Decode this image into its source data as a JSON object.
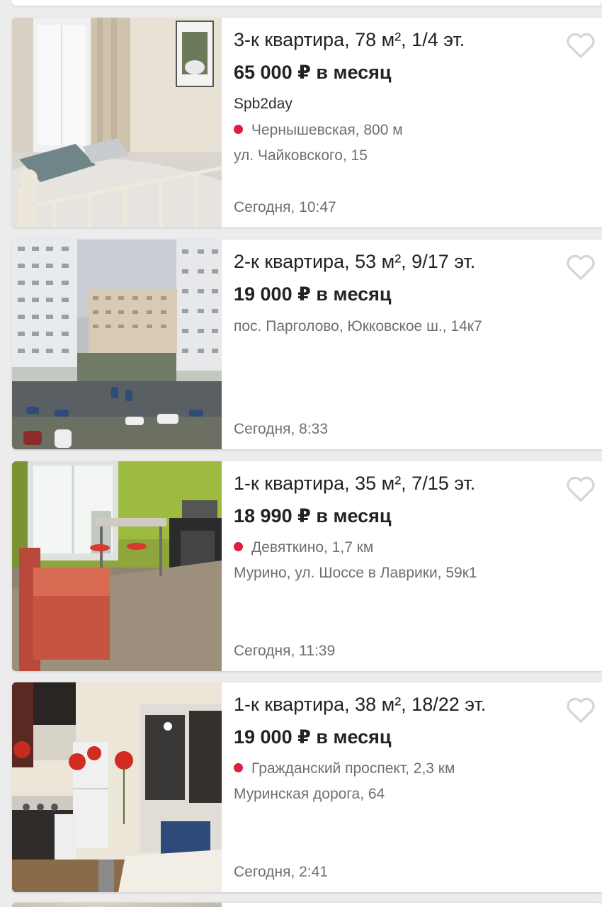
{
  "colors": {
    "background": "#ececec",
    "card": "#ffffff",
    "text_primary": "#222222",
    "text_secondary": "#6f6f6f",
    "metro_dot": "#dc1e41",
    "heart_outline": "#d5d5d5"
  },
  "listings": [
    {
      "title": "3-к квартира, 78 м², 1/4 эт.",
      "price": "65 000 ₽ в месяц",
      "seller": "Spb2day",
      "metro": "Чернышевская, 800 м",
      "address": "ул. Чайковского, 15",
      "date": "Сегодня, 10:47",
      "image_icon": "bedroom-photo",
      "favorite_icon": "heart-outline-icon"
    },
    {
      "title": "2-к квартира, 53 м², 9/17 эт.",
      "price": "19 000 ₽ в месяц",
      "address": "пос. Парголово, Юкковское ш., 14к7",
      "date": "Сегодня, 8:33",
      "image_icon": "buildings-courtyard-photo",
      "favorite_icon": "heart-outline-icon"
    },
    {
      "title": "1-к квартира, 35 м², 7/15 эт.",
      "price": "18 990 ₽ в месяц",
      "metro": "Девяткино, 1,7 км",
      "address": "Мурино, ул. Шоссе в Лаврики, 59к1",
      "date": "Сегодня, 11:39",
      "image_icon": "kitchen-green-photo",
      "favorite_icon": "heart-outline-icon"
    },
    {
      "title": "1-к квартира, 38 м², 18/22 эт.",
      "price": "19 000 ₽ в месяц",
      "metro": "Гражданский проспект, 2,3 км",
      "address": "Муринская дорога, 64",
      "date": "Сегодня, 2:41",
      "image_icon": "kitchen-poppies-photo",
      "favorite_icon": "heart-outline-icon"
    }
  ]
}
